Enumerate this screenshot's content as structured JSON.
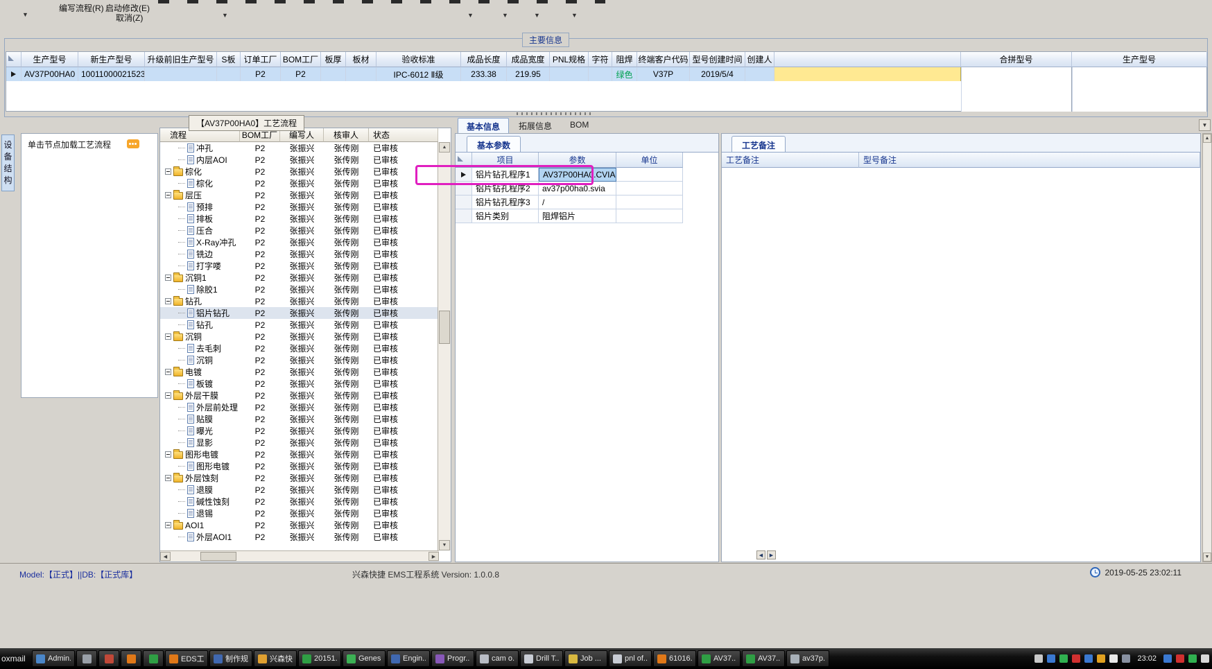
{
  "toolbar": {
    "write_flow": "编写流程(R)",
    "start_modify": "启动修改(E)",
    "cancel": "取消(Z)"
  },
  "main_info": {
    "group_title": "主要信息",
    "columns": [
      "生产型号",
      "新生产型号",
      "升级前旧生产型号",
      "S板",
      "订单工厂",
      "BOM工厂",
      "板厚",
      "板材",
      "验收标准",
      "成品长度",
      "成品宽度",
      "PNL规格",
      "字符",
      "阻焊",
      "终端客户代码",
      "型号创建时间",
      "创建人"
    ],
    "row": [
      "AV37P00HA0",
      "10011000021523",
      "",
      "",
      "P2",
      "P2",
      "",
      "",
      "IPC-6012 Ⅱ级",
      "233.38",
      "219.95",
      "",
      "",
      "绿色",
      "V37P",
      "2019/5/4",
      ""
    ],
    "right_columns": [
      "合拼型号",
      "生产型号"
    ]
  },
  "left_panel": {
    "vertical_tab": "设备结构",
    "hint": "单击节点加载工艺流程"
  },
  "flow_panel": {
    "title": "【AV37P00HA0】工艺流程",
    "columns": [
      "流程",
      "BOM工厂",
      "编写人",
      "核审人",
      "状态"
    ],
    "defaults": {
      "bom_factory": "P2",
      "writer": "张振兴",
      "auditor": "张传刚",
      "status": "已审核"
    },
    "rows": [
      {
        "label": "冲孔",
        "type": "leaf"
      },
      {
        "label": "内层AOI",
        "type": "leaf"
      },
      {
        "label": "棕化",
        "type": "folder"
      },
      {
        "label": "棕化",
        "type": "leaf"
      },
      {
        "label": "层压",
        "type": "folder"
      },
      {
        "label": "预排",
        "type": "leaf"
      },
      {
        "label": "排板",
        "type": "leaf"
      },
      {
        "label": "压合",
        "type": "leaf"
      },
      {
        "label": "X-Ray冲孔",
        "type": "leaf"
      },
      {
        "label": "铣边",
        "type": "leaf"
      },
      {
        "label": "打字喽",
        "type": "leaf"
      },
      {
        "label": "沉铜1",
        "type": "folder"
      },
      {
        "label": "除胶1",
        "type": "leaf"
      },
      {
        "label": "钻孔",
        "type": "folder"
      },
      {
        "label": "铝片钻孔",
        "type": "leaf",
        "selected": true
      },
      {
        "label": "钻孔",
        "type": "leaf"
      },
      {
        "label": "沉铜",
        "type": "folder"
      },
      {
        "label": "去毛刺",
        "type": "leaf"
      },
      {
        "label": "沉铜",
        "type": "leaf"
      },
      {
        "label": "电镀",
        "type": "folder"
      },
      {
        "label": "板镀",
        "type": "leaf"
      },
      {
        "label": "外层干膜",
        "type": "folder"
      },
      {
        "label": "外层前处理",
        "type": "leaf"
      },
      {
        "label": "贴膜",
        "type": "leaf"
      },
      {
        "label": "曝光",
        "type": "leaf"
      },
      {
        "label": "显影",
        "type": "leaf"
      },
      {
        "label": "图形电镀",
        "type": "folder"
      },
      {
        "label": "图形电镀",
        "type": "leaf"
      },
      {
        "label": "外层蚀刻",
        "type": "folder"
      },
      {
        "label": "退膜",
        "type": "leaf"
      },
      {
        "label": "碱性蚀刻",
        "type": "leaf"
      },
      {
        "label": "退锡",
        "type": "leaf"
      },
      {
        "label": "AOI1",
        "type": "folder"
      },
      {
        "label": "外层AOI1",
        "type": "leaf"
      }
    ]
  },
  "detail_panel": {
    "tabs": [
      "基本信息",
      "拓展信息",
      "BOM"
    ],
    "active_tab": "基本信息",
    "sub_tab": "基本参数",
    "columns": [
      "项目",
      "参数",
      "单位"
    ],
    "rows": [
      {
        "item": "铝片钻孔程序1",
        "value": "AV37P00HA0.CVIA",
        "unit": "",
        "selected": true
      },
      {
        "item": "铝片钻孔程序2",
        "value": "av37p00ha0.svia",
        "unit": ""
      },
      {
        "item": "铝片钻孔程序3",
        "value": "/",
        "unit": ""
      },
      {
        "item": "铝片类别",
        "value": "阻焊铝片",
        "unit": ""
      }
    ]
  },
  "notes_panel": {
    "tab": "工艺备注",
    "columns": [
      "工艺备注",
      "型号备注"
    ]
  },
  "status_bar": {
    "left": "Model:【正式】||DB:【正式库】",
    "center": "兴森快捷 EMS工程系统 Version: 1.0.0.8",
    "datetime": "2019-05-25 23:02:11"
  },
  "taskbar": {
    "edge_label": "oxmail",
    "clock": "23:02",
    "items": [
      {
        "label": "Admin...",
        "color": "#4a86c8"
      },
      {
        "label": "",
        "color": "#9aa0a8"
      },
      {
        "label": "",
        "color": "#c04838"
      },
      {
        "label": "",
        "color": "#e07818"
      },
      {
        "label": "",
        "color": "#2f9e44"
      },
      {
        "label": "EDS工...",
        "color": "#e07818"
      },
      {
        "label": "制作规...",
        "color": "#4068b0"
      },
      {
        "label": "兴森快...",
        "color": "#e0a030"
      },
      {
        "label": "20151...",
        "color": "#2f9e44"
      },
      {
        "label": "Genesis",
        "color": "#3cb054"
      },
      {
        "label": "Engin...",
        "color": "#4068b0"
      },
      {
        "label": "Progr...",
        "color": "#8858b8"
      },
      {
        "label": "cam o...",
        "color": "#b8bcc4"
      },
      {
        "label": "Drill T...",
        "color": "#c8ccd4"
      },
      {
        "label": "Job ...",
        "color": "#d8b840"
      },
      {
        "label": "pnl of...",
        "color": "#c8ccd4"
      },
      {
        "label": "61016...",
        "color": "#e07818"
      },
      {
        "label": "AV37...",
        "color": "#2f9e44"
      },
      {
        "label": "AV37...",
        "color": "#2f9e44"
      },
      {
        "label": "av37p...",
        "color": "#a8b0b8"
      }
    ],
    "tray_icons": [
      {
        "name": "printer-icon",
        "color": "#c8c8c8"
      },
      {
        "name": "update-icon",
        "color": "#3a78d0"
      },
      {
        "name": "chat-icon",
        "color": "#30b050"
      },
      {
        "name": "security-icon",
        "color": "#d03030"
      },
      {
        "name": "network-icon",
        "color": "#3a78d0"
      },
      {
        "name": "app-tray-icon",
        "color": "#e0a020"
      },
      {
        "name": "volume-icon",
        "color": "#e8e8e8"
      },
      {
        "name": "device-icon",
        "color": "#8890a0"
      }
    ],
    "tray_icons_right": [
      {
        "name": "sync-icon",
        "color": "#3a78d0"
      },
      {
        "name": "alert-icon",
        "color": "#d03030"
      },
      {
        "name": "im-icon",
        "color": "#30b050"
      },
      {
        "name": "input-method-icon",
        "color": "#d8d8d8"
      }
    ]
  },
  "colors": {
    "selected_row": "#c8def6",
    "pending_cell_yellow": "#ffe992",
    "highlight_magenta": "#e01fc0",
    "solder_mask_green_text": "#00a050"
  }
}
